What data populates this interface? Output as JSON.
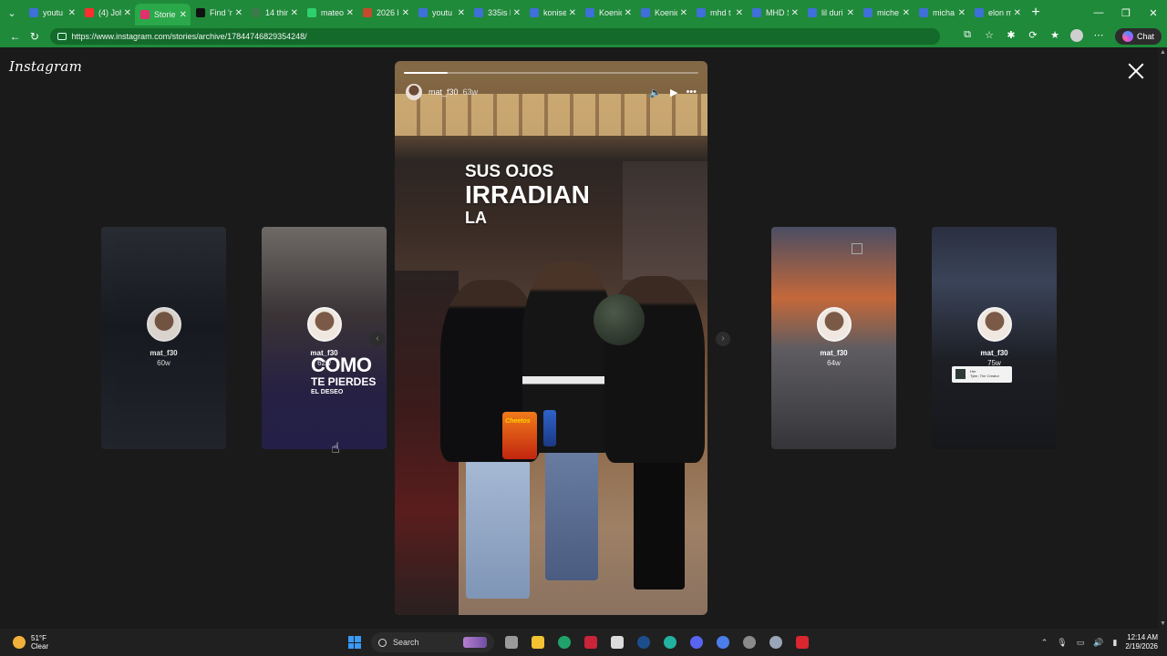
{
  "browser": {
    "tabs": [
      {
        "label": "youtu",
        "color": "#3f6fd8",
        "active": false
      },
      {
        "label": "(4) Joh",
        "color": "#ff2d2d",
        "active": false
      },
      {
        "label": "Storie",
        "color": "#e1306c",
        "active": true
      },
      {
        "label": "Find 'r",
        "color": "#111111",
        "active": false
      },
      {
        "label": "14 thin",
        "color": "#3d7a4a",
        "active": false
      },
      {
        "label": "mateo",
        "color": "#2ed06e",
        "active": false
      },
      {
        "label": "2026 l",
        "color": "#c44b2e",
        "active": false
      },
      {
        "label": "youtu",
        "color": "#3f6fd8",
        "active": false
      },
      {
        "label": "335is l",
        "color": "#3f6fd8",
        "active": false
      },
      {
        "label": "konise",
        "color": "#3f6fd8",
        "active": false
      },
      {
        "label": "Koenic",
        "color": "#3f6fd8",
        "active": false
      },
      {
        "label": "Koenic",
        "color": "#3f6fd8",
        "active": false
      },
      {
        "label": "mhd t",
        "color": "#3f6fd8",
        "active": false
      },
      {
        "label": "MHD S",
        "color": "#3f6fd8",
        "active": false
      },
      {
        "label": "lil duri",
        "color": "#3f6fd8",
        "active": false
      },
      {
        "label": "miche",
        "color": "#3f6fd8",
        "active": false
      },
      {
        "label": "micha",
        "color": "#3f6fd8",
        "active": false
      },
      {
        "label": "elon m",
        "color": "#3f6fd8",
        "active": false
      }
    ],
    "url": "https://www.instagram.com/stories/archive/17844746829354248/",
    "chat_label": "Chat"
  },
  "page": {
    "brand": "Instagram"
  },
  "story": {
    "username": "mat_f30",
    "time": "63w",
    "progress": 0.15,
    "text_line1": "SUS OJOS",
    "text_line2": "IRRADIAN",
    "text_line3": "LA",
    "bag_label": "Cheetos"
  },
  "previews": [
    {
      "username": "mat_f30",
      "time": "60w"
    },
    {
      "username": "mat_f30",
      "time": "62w",
      "caption1": "COMO",
      "caption2": "TE PIERDES",
      "caption3": "EL DESEO"
    },
    {
      "username": "mat_f30",
      "time": "64w"
    },
    {
      "username": "mat_f30",
      "time": "75w",
      "badge_line1": "Her",
      "badge_line2": "Tyler, The Creator"
    }
  ],
  "taskbar": {
    "weather_temp": "51°F",
    "weather_desc": "Clear",
    "search_label": "Search",
    "time": "12:14 AM",
    "date": "2/19/2026"
  }
}
